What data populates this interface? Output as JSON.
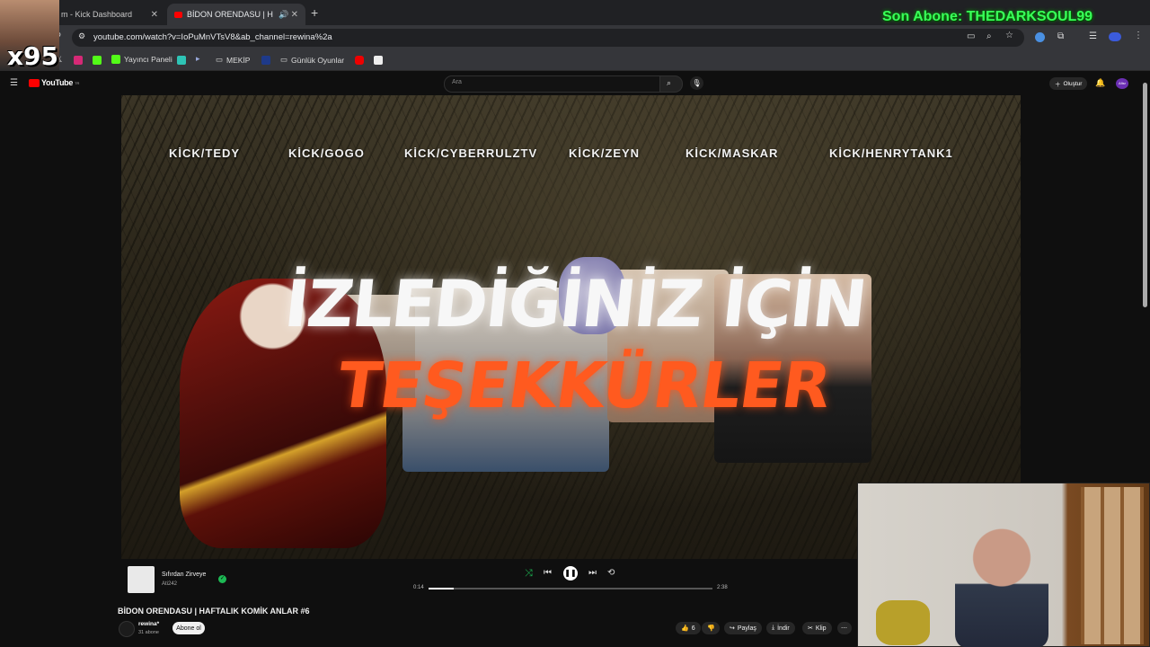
{
  "browser": {
    "tabs": [
      {
        "label": "m - Kick Dashboard",
        "active": false
      },
      {
        "label": "BİDON ORENDASU | HAFTA",
        "active": true
      }
    ],
    "url": "youtube.com/watch?v=IoPuMnVTsV8&ab_channel=rewina%2a",
    "bookmarks": [
      "Yayıncı Paneli",
      "MEKİP",
      "Günlük Oyunlar"
    ]
  },
  "youtube": {
    "logo": "YouTube",
    "logo_sup": "TR",
    "search_placeholder": "Ara",
    "create_label": "Oluştur",
    "avatar_label": "Afisr"
  },
  "video": {
    "credits": [
      "KİCK/TEDY",
      "KİCK/GOGO",
      "KİCK/CYBERRULZTV",
      "KİCK/ZEYN",
      "KİCK/MASKAR",
      "KİCK/HENRYTANK1"
    ],
    "headline": "İZLEDİĞİNİZ İÇİN",
    "subline": "TEŞEKKÜRLER"
  },
  "music": {
    "song": "Sıfırdan Zirveye",
    "artist": "Ati242",
    "current_time": "0:14",
    "total_time": "2:38",
    "progress": 0.09
  },
  "below": {
    "title": "BİDON ORENDASU | HAFTALIK KOMİK ANLAR #6",
    "channel": "rewina*",
    "subs": "31 abone",
    "subscribe": "Abone ol",
    "likes": "6",
    "share": "Paylaş",
    "download": "İndir",
    "clip": "Klip"
  },
  "overlay": {
    "multiplier": "x95",
    "last_sub": "Son Abone: THEDARKSOUL99"
  }
}
